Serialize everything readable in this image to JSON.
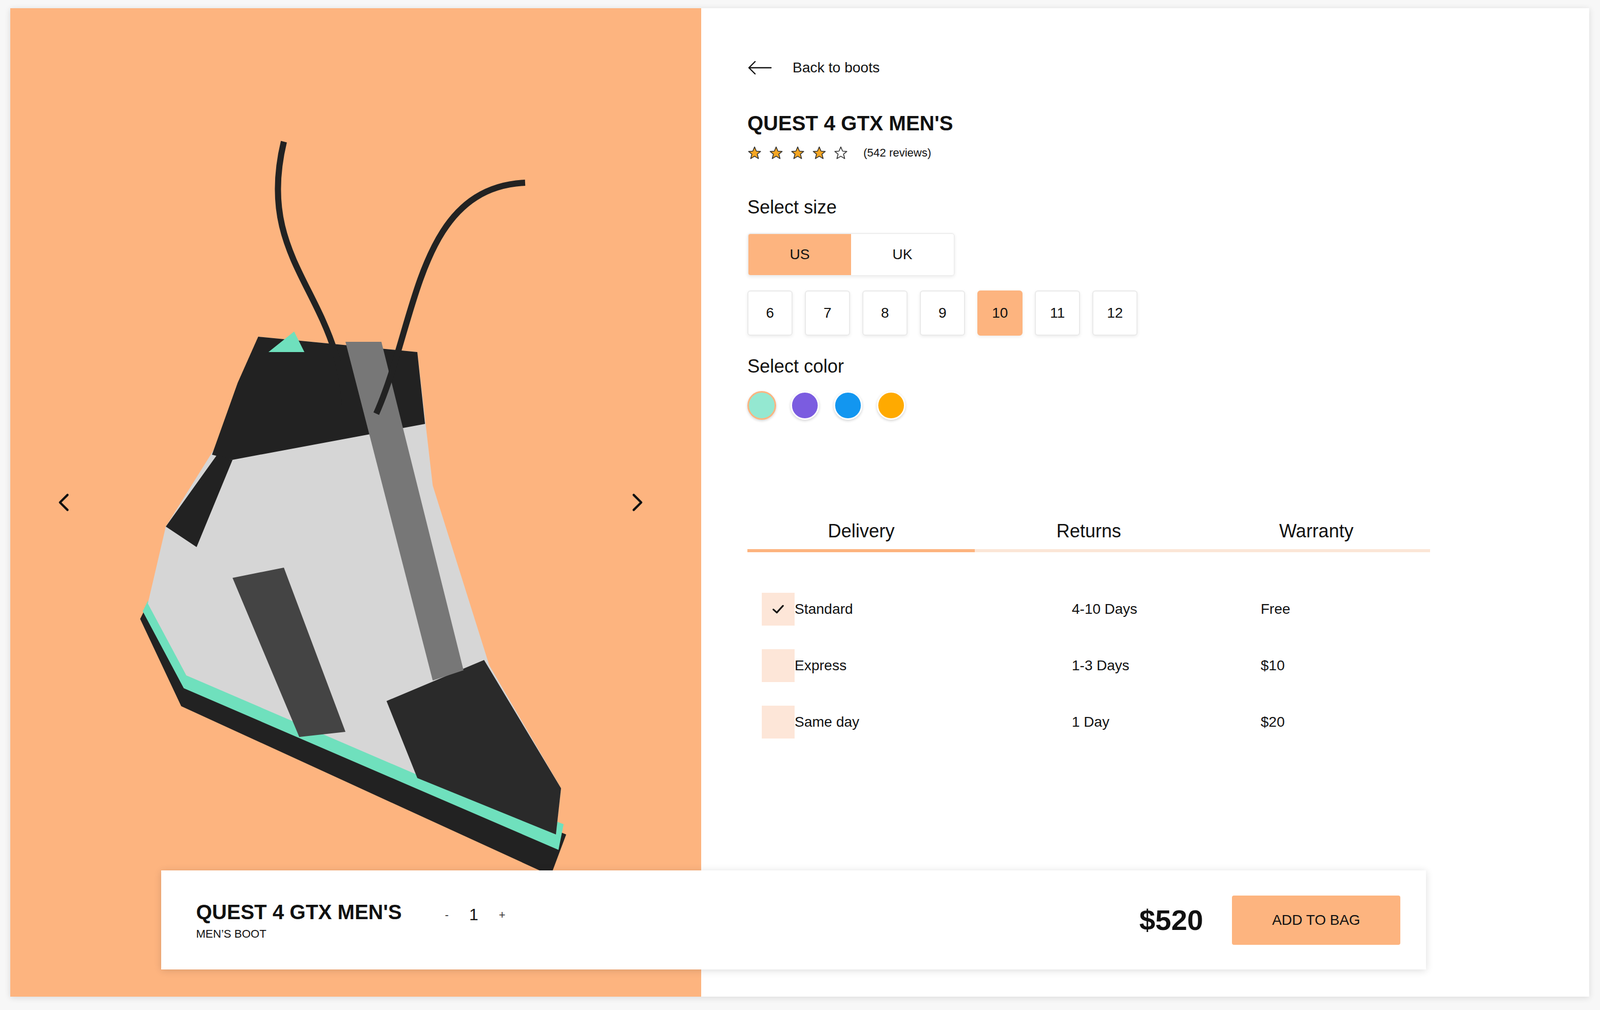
{
  "back": {
    "label": "Back to boots"
  },
  "product": {
    "title": "QUEST 4 GTX MEN'S",
    "stars": 4,
    "reviews": "(542 reviews)"
  },
  "size": {
    "heading": "Select size",
    "systems": [
      {
        "label": "US",
        "selected": true
      },
      {
        "label": "UK",
        "selected": false
      }
    ],
    "options": [
      {
        "label": "6",
        "selected": false
      },
      {
        "label": "7",
        "selected": false
      },
      {
        "label": "8",
        "selected": false
      },
      {
        "label": "9",
        "selected": false
      },
      {
        "label": "10",
        "selected": true
      },
      {
        "label": "11",
        "selected": false
      },
      {
        "label": "12",
        "selected": false
      }
    ]
  },
  "color": {
    "heading": "Select color",
    "options": [
      {
        "color": "#94e8d1",
        "selected": true
      },
      {
        "color": "#7b5ce0",
        "selected": false
      },
      {
        "color": "#1296f0",
        "selected": false
      },
      {
        "color": "#ffaa00",
        "selected": false
      }
    ]
  },
  "info_tabs": [
    {
      "label": "Delivery",
      "selected": true
    },
    {
      "label": "Returns",
      "selected": false
    },
    {
      "label": "Warranty",
      "selected": false
    }
  ],
  "delivery": [
    {
      "name": "Standard",
      "time": "4-10 Days",
      "price": "Free",
      "checked": true
    },
    {
      "name": "Express",
      "time": "1-3 Days",
      "price": "$10",
      "checked": false
    },
    {
      "name": "Same day",
      "time": "1 Day",
      "price": "$20",
      "checked": false
    }
  ],
  "cart": {
    "title": "QUEST 4 GTX MEN'S",
    "subtitle": "MEN’S BOOT",
    "decrement": "-",
    "quantity": "1",
    "increment": "+",
    "price": "$520",
    "button": "ADD TO BAG"
  }
}
